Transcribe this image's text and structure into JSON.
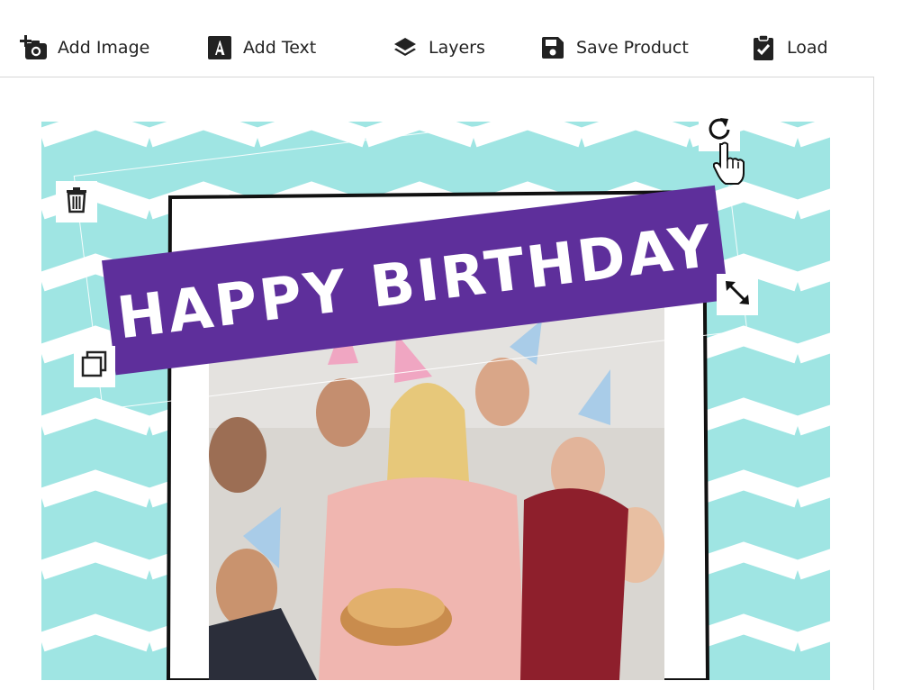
{
  "toolbar": {
    "add_image": "Add Image",
    "add_text": "Add Text",
    "layers": "Layers",
    "save_product": "Save Product",
    "load": "Load"
  },
  "design": {
    "banner_text": "HAPPY BIRTHDAY",
    "banner_color": "#5e2f9b",
    "chevron_color": "#9fe5e3"
  },
  "icons": {
    "add_image": "add-photo-icon",
    "add_text": "text-a-icon",
    "layers": "layers-icon",
    "save": "floppy-disk-icon",
    "load": "clipboard-check-icon",
    "delete": "trash-icon",
    "duplicate": "copy-icon",
    "rotate": "rotate-icon",
    "resize": "resize-arrows-icon",
    "cursor": "hand-pointer-icon"
  }
}
